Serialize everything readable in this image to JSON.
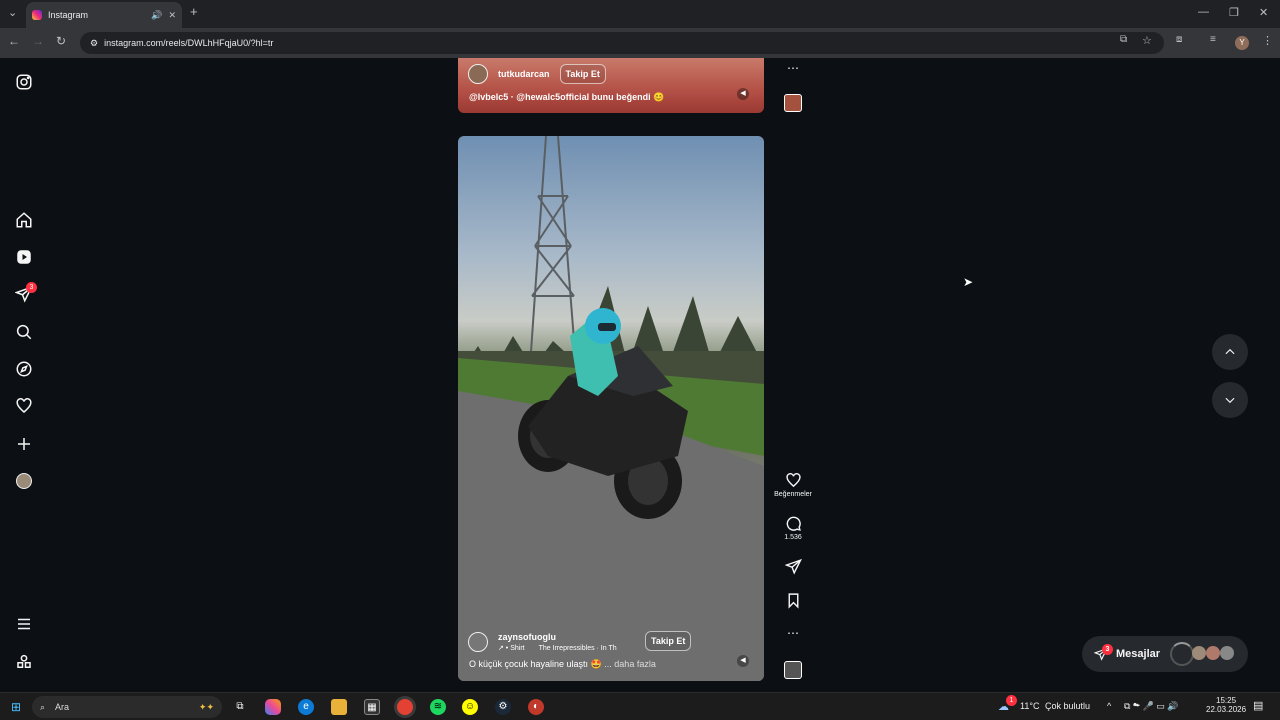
{
  "browser": {
    "tab_title": "Instagram",
    "url": "instagram.com/reels/DWLhHFqjaU0/?hl=tr",
    "profile_initial": "Y"
  },
  "sidebar": {
    "items": [
      {
        "name": "instagram-logo-icon"
      },
      {
        "name": "home-icon"
      },
      {
        "name": "reels-icon"
      },
      {
        "name": "messages-icon",
        "badge": "3"
      },
      {
        "name": "search-icon"
      },
      {
        "name": "explore-icon"
      },
      {
        "name": "notifications-icon"
      },
      {
        "name": "create-icon"
      },
      {
        "name": "profile-icon"
      },
      {
        "name": "more-menu-icon"
      },
      {
        "name": "meta-apps-icon"
      }
    ]
  },
  "reel_top": {
    "username": "tutkudarcan",
    "follow_label": "Takip Et",
    "liked_by": "@lvbelc5 · @hewalc5official bunu beğendi 😊"
  },
  "reel_main": {
    "username": "zaynsofuoglu",
    "audio_prefix": "↗ • Shirt",
    "audio_track": "The Irrepressibles · In Th",
    "follow_label": "Takip Et",
    "caption": "O küçük çocuk hayaline ulaştı 🤩",
    "more_label": "... daha fazla"
  },
  "actions": {
    "likes_label": "Beğenmeler",
    "comments_count": "1.536"
  },
  "messages": {
    "label": "Mesajlar",
    "badge": "3"
  },
  "taskbar": {
    "search_placeholder": "Ara",
    "weather_temp": "11°C",
    "weather_text": "Çok bulutlu",
    "weather_badge": "1",
    "time": "15:25",
    "date": "22.03.2026"
  }
}
